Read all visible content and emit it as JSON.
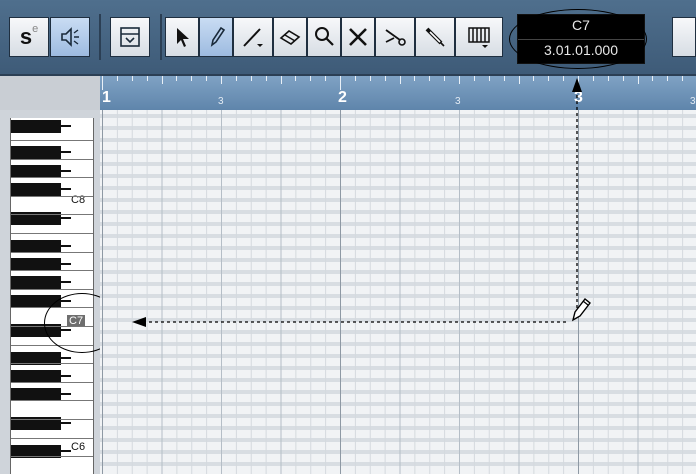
{
  "toolbar": {
    "solo_button": {
      "main": "s",
      "superscript": "e"
    },
    "tools": [
      "object-select-icon",
      "pencil-icon",
      "line-icon",
      "erase-icon",
      "zoom-icon",
      "mute-icon",
      "split-icon",
      "glue-icon",
      "quantize-grid-icon"
    ]
  },
  "mouse_display": {
    "note": "C7",
    "position": "3.01.01.000"
  },
  "ruler": {
    "labels": [
      {
        "text": "1",
        "kind": "big"
      },
      {
        "text": "3",
        "kind": "small"
      },
      {
        "text": "2",
        "kind": "big"
      },
      {
        "text": "3",
        "kind": "small"
      },
      {
        "text": "3",
        "kind": "big"
      },
      {
        "text": "3",
        "kind": "small"
      }
    ]
  },
  "keyboard": {
    "labels": [
      {
        "text": "C8",
        "highlight": false
      },
      {
        "text": "C7",
        "highlight": true
      },
      {
        "text": "C6",
        "highlight": false
      }
    ]
  },
  "colors": {
    "toolbar_bg": "#4a6a89",
    "ruler_bg": "#6f93b8",
    "grid_bg": "#f1f3f5",
    "active_tool": "#b3cdea"
  }
}
